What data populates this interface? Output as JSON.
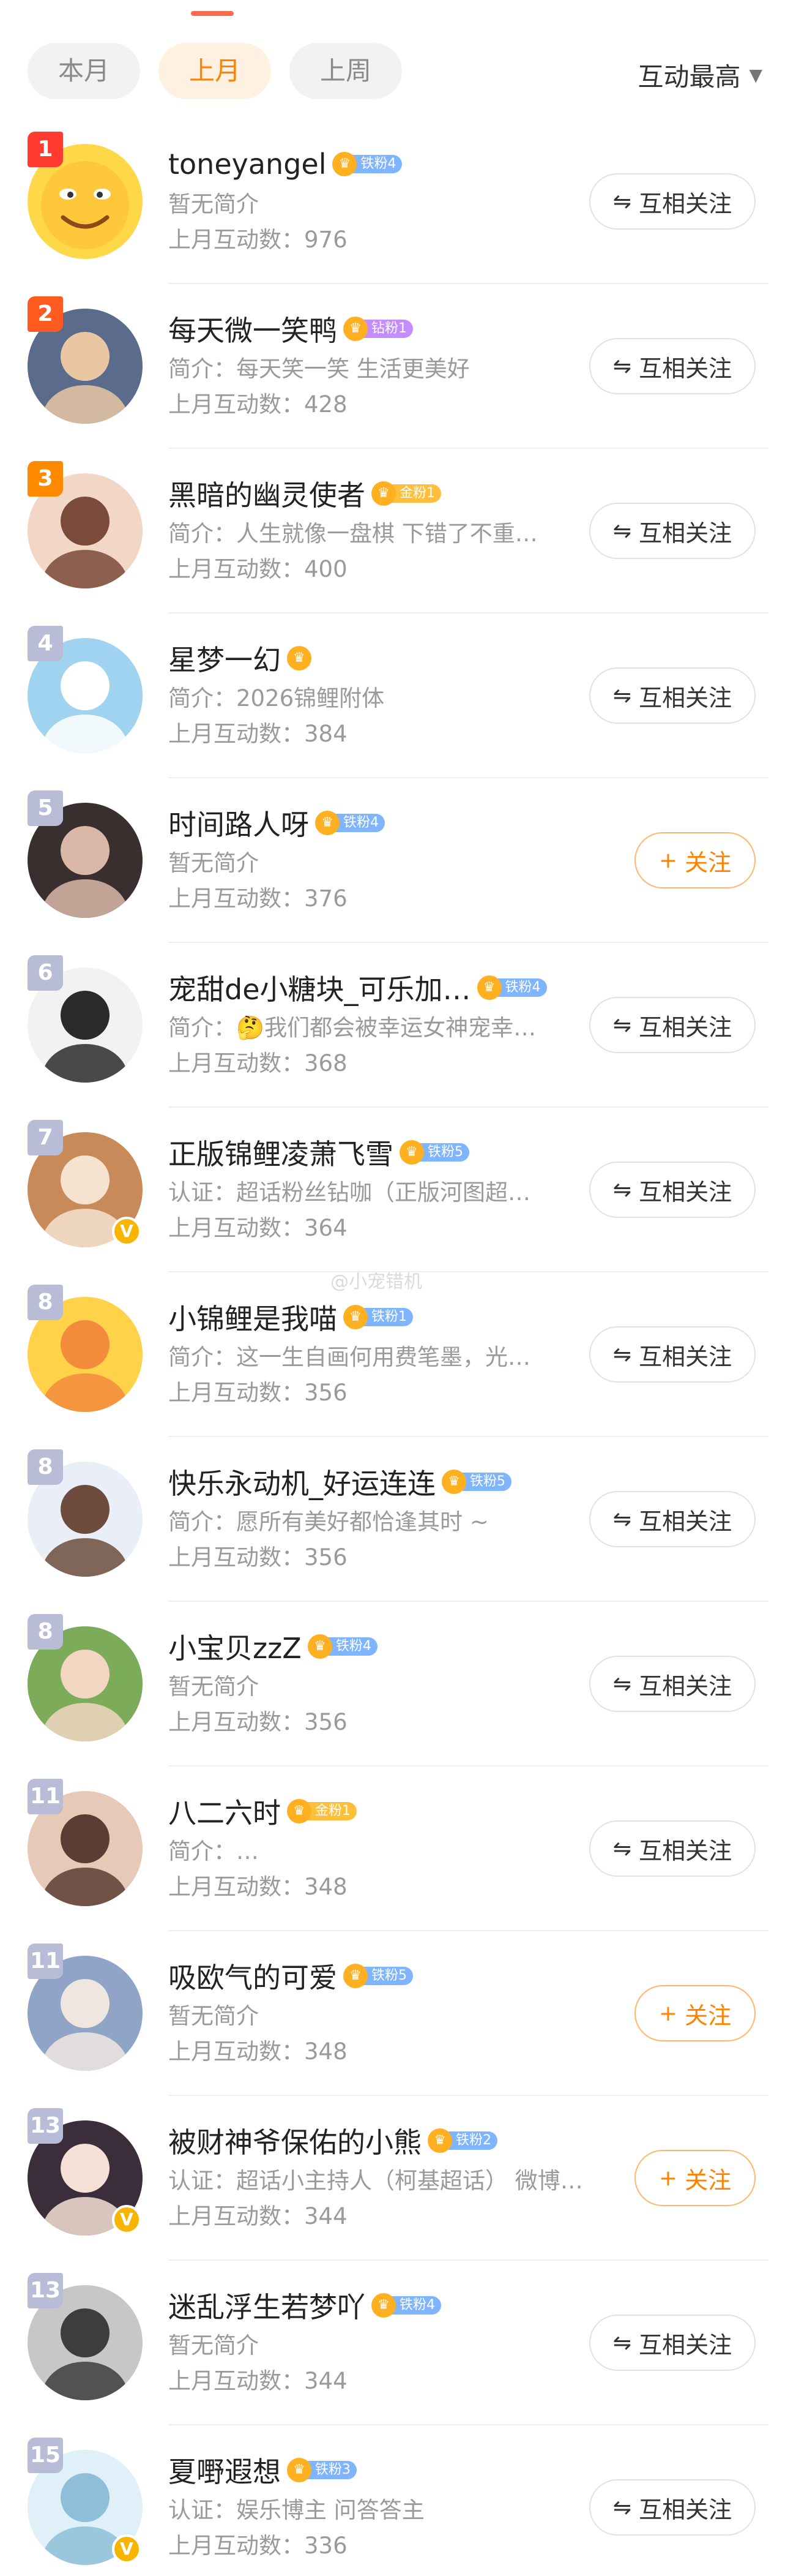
{
  "tabs": [
    {
      "label": "本月",
      "active": false
    },
    {
      "label": "上月",
      "active": true
    },
    {
      "label": "上周",
      "active": false
    }
  ],
  "sort": {
    "label": "互动最高"
  },
  "watermark": "@小宠错机",
  "items": [
    {
      "rank": "1",
      "name": "toneyangel",
      "fan": "铁粉4",
      "fan_type": "iron",
      "desc": "暂无简介",
      "count": "上月互动数：976",
      "button": "互相关注",
      "btn_type": "mutual",
      "verified": false
    },
    {
      "rank": "2",
      "name": "每天微一笑鸭",
      "fan": "钻粉1",
      "fan_type": "diamond",
      "desc": "简介：每天笑一笑 生活更美好",
      "count": "上月互动数：428",
      "button": "互相关注",
      "btn_type": "mutual",
      "verified": false
    },
    {
      "rank": "3",
      "name": "黑暗的幽灵使者",
      "fan": "金粉1",
      "fan_type": "gold",
      "desc": "简介：人生就像一盘棋 下错了不重…",
      "count": "上月互动数：400",
      "button": "互相关注",
      "btn_type": "mutual",
      "verified": false
    },
    {
      "rank": "4",
      "name": "星梦一幻",
      "fan": "",
      "fan_type": "none",
      "desc": "简介：2026锦鲤附体",
      "count": "上月互动数：384",
      "button": "互相关注",
      "btn_type": "mutual",
      "verified": false
    },
    {
      "rank": "5",
      "name": "时间路人呀",
      "fan": "铁粉4",
      "fan_type": "iron",
      "desc": "暂无简介",
      "count": "上月互动数：376",
      "button": "关注",
      "btn_type": "follow",
      "verified": false
    },
    {
      "rank": "6",
      "name": "宠甜de小糖块_可乐加…",
      "fan": "铁粉4",
      "fan_type": "iron",
      "desc": "简介：🤔我们都会被幸运女神宠幸…",
      "count": "上月互动数：368",
      "button": "互相关注",
      "btn_type": "mutual",
      "verified": false
    },
    {
      "rank": "7",
      "name": "正版锦鲤凌萧飞雪",
      "fan": "铁粉5",
      "fan_type": "iron",
      "desc": "认证：超话粉丝钻咖（正版河图超…",
      "count": "上月互动数：364",
      "button": "互相关注",
      "btn_type": "mutual",
      "verified": true
    },
    {
      "rank": "8",
      "name": "小锦鲤是我喵",
      "fan": "铁粉1",
      "fan_type": "iron",
      "desc": "简介：这一生自画何用费笔墨，光…",
      "count": "上月互动数：356",
      "button": "互相关注",
      "btn_type": "mutual",
      "verified": false
    },
    {
      "rank": "8",
      "name": "快乐永动机_好运连连",
      "fan": "铁粉5",
      "fan_type": "iron",
      "desc": "简介：愿所有美好都恰逢其时 ~",
      "count": "上月互动数：356",
      "button": "互相关注",
      "btn_type": "mutual",
      "verified": false
    },
    {
      "rank": "8",
      "name": "小宝贝zzZ",
      "fan": "铁粉4",
      "fan_type": "iron",
      "desc": "暂无简介",
      "count": "上月互动数：356",
      "button": "互相关注",
      "btn_type": "mutual",
      "verified": false
    },
    {
      "rank": "11",
      "name": "八二六时",
      "fan": "金粉1",
      "fan_type": "gold",
      "desc": "简介：…",
      "count": "上月互动数：348",
      "button": "互相关注",
      "btn_type": "mutual",
      "verified": false
    },
    {
      "rank": "11",
      "name": "吸欧气的可爱",
      "fan": "铁粉5",
      "fan_type": "iron",
      "desc": "暂无简介",
      "count": "上月互动数：348",
      "button": "关注",
      "btn_type": "follow",
      "verified": false
    },
    {
      "rank": "13",
      "name": "被财神爷保佑的小熊",
      "fan": "铁粉2",
      "fan_type": "iron",
      "desc": "认证：超话小主持人（柯基超话） 微博…",
      "count": "上月互动数：344",
      "button": "关注",
      "btn_type": "follow",
      "verified": true
    },
    {
      "rank": "13",
      "name": "迷乱浮生若梦吖",
      "fan": "铁粉4",
      "fan_type": "iron",
      "desc": "暂无简介",
      "count": "上月互动数：344",
      "button": "互相关注",
      "btn_type": "mutual",
      "verified": false
    },
    {
      "rank": "15",
      "name": "夏嘢遐想",
      "fan": "铁粉3",
      "fan_type": "iron",
      "desc": "认证：娱乐博主 问答答主",
      "count": "上月互动数：336",
      "button": "互相关注",
      "btn_type": "mutual",
      "verified": true
    }
  ]
}
